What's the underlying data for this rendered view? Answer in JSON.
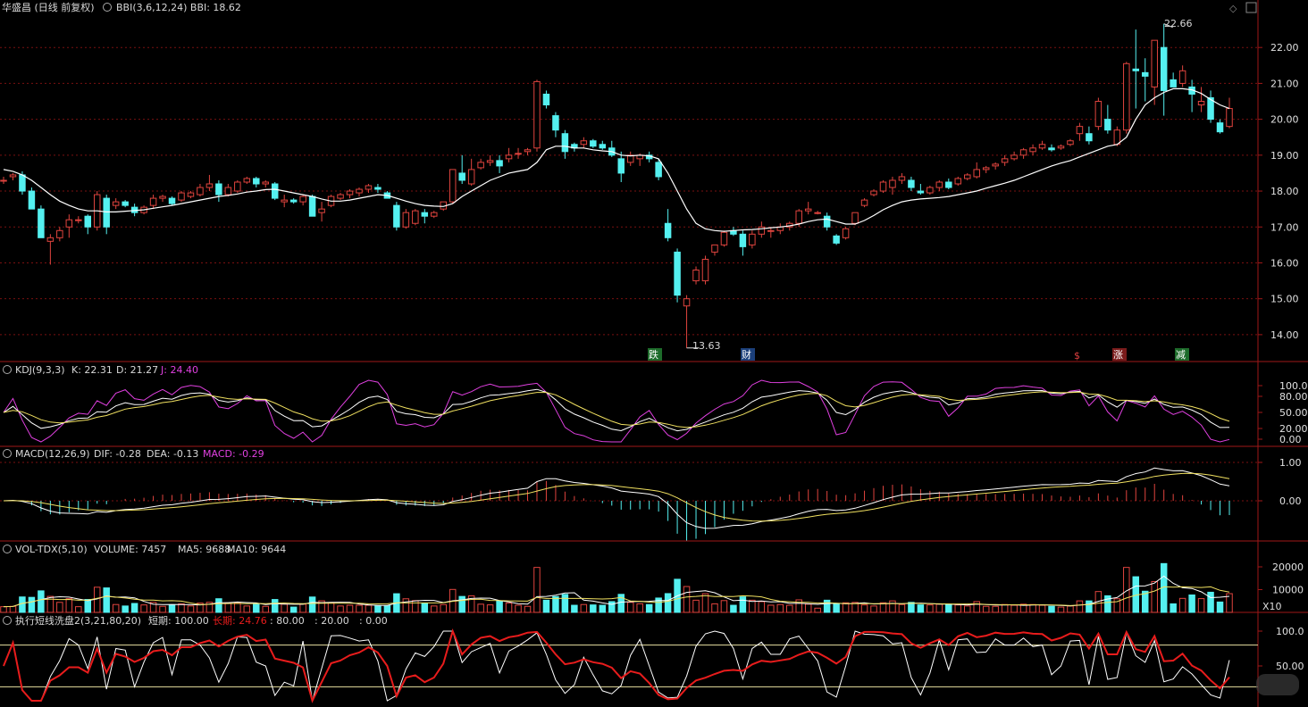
{
  "colors": {
    "up": "#e0443e",
    "down": "#54f0f0",
    "grid": "#7a1010",
    "border": "#a01818",
    "white": "#ffffff",
    "yellow": "#f0e060",
    "magenta": "#e040e0",
    "red": "#e81c1c",
    "green_badge": "#1d6b2a",
    "blue_badge": "#1b3f7a",
    "red_badge": "#7a1b1b"
  },
  "price_panel": {
    "title": "华盛昌 (日线 前复权)",
    "indicator_text": "BBI(3,6,12,24)  BBI: 18.62",
    "y_ticks": [
      "22.00",
      "21.00",
      "20.00",
      "19.00",
      "18.00",
      "17.00",
      "16.00",
      "15.00",
      "14.00"
    ],
    "high_label": "22.66",
    "low_label": "13.63",
    "badges": [
      "跌",
      "财",
      "$",
      "涨",
      "减"
    ]
  },
  "kdj_panel": {
    "name": "KDJ(9,3,3)",
    "k": "K: 22.31",
    "d": "D: 21.27",
    "j": "J: 24.40",
    "y_ticks": [
      "100.00",
      "80.00",
      "50.00",
      "20.00",
      "0.00"
    ]
  },
  "macd_panel": {
    "name": "MACD(12,26,9)",
    "dif": "DIF: -0.28",
    "dea": "DEA: -0.13",
    "macd": "MACD: -0.29",
    "y_ticks": [
      "1.00",
      "0.00"
    ]
  },
  "vol_panel": {
    "name": "VOL-TDX(5,10)",
    "volume": "VOLUME: 7457",
    "ma5": "MA5: 9688",
    "ma10": "MA10: 9644",
    "y_ticks": [
      "20000",
      "10000"
    ],
    "unit": "X10"
  },
  "osc_panel": {
    "name": "执行短线洗盘2(3,21,80,20)",
    "short": "短期: 100.00",
    "long": "长期: 24.76",
    "t80": ": 80.00",
    "t20": ": 20.00",
    "t0": ": 0.00",
    "y_ticks": [
      "100.0",
      "50.00"
    ]
  },
  "chart_data": {
    "type": "candlestick",
    "ylim": [
      13.5,
      22.9
    ],
    "candles": [
      [
        18.3,
        18.4,
        18.2,
        18.3
      ],
      [
        18.4,
        18.5,
        18.3,
        18.45
      ],
      [
        18.45,
        18.55,
        17.9,
        18.0
      ],
      [
        18.0,
        18.1,
        17.5,
        17.5
      ],
      [
        17.5,
        17.6,
        16.7,
        16.7
      ],
      [
        16.6,
        16.8,
        15.95,
        16.7
      ],
      [
        16.7,
        17.0,
        16.6,
        16.9
      ],
      [
        17.0,
        17.35,
        16.7,
        17.2
      ],
      [
        17.2,
        17.3,
        17.1,
        17.2
      ],
      [
        17.3,
        17.35,
        16.8,
        17.0
      ],
      [
        17.0,
        18.0,
        16.9,
        17.9
      ],
      [
        17.8,
        17.9,
        16.8,
        17.0
      ],
      [
        17.6,
        17.8,
        17.5,
        17.7
      ],
      [
        17.7,
        17.75,
        17.55,
        17.6
      ],
      [
        17.55,
        17.65,
        17.3,
        17.4
      ],
      [
        17.4,
        17.6,
        17.35,
        17.55
      ],
      [
        17.6,
        17.9,
        17.5,
        17.8
      ],
      [
        17.8,
        17.9,
        17.7,
        17.85
      ],
      [
        17.8,
        17.85,
        17.6,
        17.65
      ],
      [
        17.75,
        18.0,
        17.7,
        17.95
      ],
      [
        17.85,
        18.0,
        17.8,
        17.95
      ],
      [
        17.9,
        18.2,
        17.85,
        18.1
      ],
      [
        18.1,
        18.45,
        18.0,
        18.2
      ],
      [
        18.2,
        18.3,
        17.7,
        17.9
      ],
      [
        17.9,
        18.2,
        17.85,
        18.1
      ],
      [
        18.0,
        18.3,
        17.95,
        18.25
      ],
      [
        18.25,
        18.4,
        18.2,
        18.35
      ],
      [
        18.35,
        18.4,
        18.1,
        18.2
      ],
      [
        18.2,
        18.3,
        18.1,
        18.25
      ],
      [
        18.2,
        18.25,
        17.75,
        17.8
      ],
      [
        17.7,
        17.9,
        17.55,
        17.75
      ],
      [
        17.75,
        17.8,
        17.65,
        17.7
      ],
      [
        17.7,
        17.9,
        17.6,
        17.85
      ],
      [
        17.85,
        17.9,
        17.3,
        17.3
      ],
      [
        17.4,
        17.7,
        17.15,
        17.5
      ],
      [
        17.6,
        17.9,
        17.55,
        17.85
      ],
      [
        17.8,
        17.95,
        17.75,
        17.9
      ],
      [
        17.9,
        18.05,
        17.8,
        18.0
      ],
      [
        17.95,
        18.1,
        17.85,
        18.05
      ],
      [
        18.05,
        18.2,
        17.95,
        18.15
      ],
      [
        18.1,
        18.2,
        17.95,
        18.05
      ],
      [
        17.95,
        18.0,
        17.8,
        17.8
      ],
      [
        17.6,
        17.7,
        16.9,
        17.0
      ],
      [
        17.0,
        17.5,
        16.95,
        17.4
      ],
      [
        17.1,
        17.5,
        17.05,
        17.45
      ],
      [
        17.4,
        17.5,
        17.1,
        17.3
      ],
      [
        17.3,
        17.45,
        17.25,
        17.4
      ],
      [
        17.5,
        17.7,
        17.45,
        17.7
      ],
      [
        17.7,
        18.6,
        17.65,
        18.6
      ],
      [
        18.5,
        19.0,
        18.2,
        18.3
      ],
      [
        18.2,
        18.9,
        18.15,
        18.6
      ],
      [
        18.65,
        18.9,
        18.6,
        18.8
      ],
      [
        18.8,
        19.0,
        18.7,
        18.85
      ],
      [
        18.85,
        19.0,
        18.5,
        18.7
      ],
      [
        18.9,
        19.2,
        18.8,
        19.0
      ],
      [
        19.05,
        19.2,
        18.9,
        19.05
      ],
      [
        19.1,
        19.2,
        19.0,
        19.15
      ],
      [
        19.2,
        21.1,
        19.1,
        21.05
      ],
      [
        20.7,
        20.8,
        20.3,
        20.4
      ],
      [
        20.1,
        20.2,
        19.5,
        19.7
      ],
      [
        19.6,
        19.7,
        18.9,
        19.1
      ],
      [
        19.3,
        19.35,
        19.1,
        19.2
      ],
      [
        19.3,
        19.5,
        19.2,
        19.4
      ],
      [
        19.4,
        19.45,
        19.2,
        19.25
      ],
      [
        19.3,
        19.4,
        19.15,
        19.2
      ],
      [
        19.2,
        19.4,
        18.95,
        19.0
      ],
      [
        18.9,
        19.1,
        18.25,
        18.5
      ],
      [
        18.8,
        19.1,
        18.7,
        19.0
      ],
      [
        18.9,
        19.05,
        18.7,
        19.0
      ],
      [
        19.0,
        19.1,
        18.8,
        18.9
      ],
      [
        18.8,
        18.9,
        18.3,
        18.4
      ],
      [
        17.1,
        17.5,
        16.6,
        16.7
      ],
      [
        16.3,
        16.4,
        14.9,
        15.1
      ],
      [
        14.8,
        15.1,
        13.63,
        15.0
      ],
      [
        15.5,
        15.9,
        15.4,
        15.8
      ],
      [
        15.5,
        16.2,
        15.4,
        16.1
      ],
      [
        16.3,
        16.5,
        16.2,
        16.5
      ],
      [
        16.5,
        16.9,
        16.45,
        16.85
      ],
      [
        16.9,
        17.0,
        16.75,
        16.8
      ],
      [
        16.8,
        16.9,
        16.2,
        16.45
      ],
      [
        16.5,
        16.9,
        16.4,
        16.8
      ],
      [
        16.8,
        17.15,
        16.7,
        17.0
      ],
      [
        16.9,
        17.0,
        16.7,
        16.9
      ],
      [
        16.9,
        17.1,
        16.8,
        17.0
      ],
      [
        17.0,
        17.15,
        16.9,
        17.1
      ],
      [
        17.1,
        17.5,
        17.0,
        17.45
      ],
      [
        17.45,
        17.7,
        17.35,
        17.5
      ],
      [
        17.4,
        17.45,
        17.35,
        17.4
      ],
      [
        17.3,
        17.4,
        16.9,
        17.0
      ],
      [
        16.75,
        16.8,
        16.5,
        16.55
      ],
      [
        16.7,
        17.0,
        16.65,
        16.95
      ],
      [
        17.1,
        17.4,
        17.05,
        17.4
      ],
      [
        17.6,
        17.8,
        17.55,
        17.75
      ],
      [
        17.9,
        18.05,
        17.85,
        18.0
      ],
      [
        18.0,
        18.3,
        17.95,
        18.25
      ],
      [
        18.1,
        18.4,
        17.9,
        18.3
      ],
      [
        18.3,
        18.5,
        18.2,
        18.4
      ],
      [
        18.3,
        18.4,
        18.0,
        18.1
      ],
      [
        18.0,
        18.2,
        17.9,
        17.95
      ],
      [
        17.95,
        18.15,
        17.9,
        18.1
      ],
      [
        18.1,
        18.3,
        18.0,
        18.25
      ],
      [
        18.25,
        18.35,
        18.05,
        18.1
      ],
      [
        18.2,
        18.4,
        18.15,
        18.35
      ],
      [
        18.35,
        18.5,
        18.3,
        18.45
      ],
      [
        18.4,
        18.8,
        18.35,
        18.6
      ],
      [
        18.6,
        18.7,
        18.5,
        18.65
      ],
      [
        18.7,
        18.8,
        18.6,
        18.75
      ],
      [
        18.8,
        19.0,
        18.7,
        18.9
      ],
      [
        18.9,
        19.1,
        18.85,
        19.0
      ],
      [
        19.0,
        19.2,
        18.9,
        19.15
      ],
      [
        19.1,
        19.3,
        19.0,
        19.2
      ],
      [
        19.2,
        19.4,
        19.15,
        19.3
      ],
      [
        19.2,
        19.3,
        19.1,
        19.15
      ],
      [
        19.2,
        19.3,
        19.15,
        19.25
      ],
      [
        19.3,
        19.45,
        19.25,
        19.4
      ],
      [
        19.6,
        19.9,
        19.4,
        19.8
      ],
      [
        19.6,
        19.8,
        19.3,
        19.4
      ],
      [
        19.8,
        20.6,
        19.7,
        20.5
      ],
      [
        20.0,
        20.4,
        19.6,
        19.7
      ],
      [
        19.3,
        19.8,
        19.25,
        19.7
      ],
      [
        19.7,
        21.6,
        19.6,
        21.55
      ],
      [
        21.4,
        22.5,
        20.3,
        21.35
      ],
      [
        21.3,
        21.7,
        20.5,
        21.2
      ],
      [
        20.9,
        21.7,
        20.4,
        22.2
      ],
      [
        22.0,
        22.66,
        20.1,
        20.8
      ],
      [
        21.1,
        21.3,
        21.0,
        20.9
      ],
      [
        21.0,
        21.5,
        20.9,
        21.35
      ],
      [
        20.9,
        21.1,
        20.2,
        20.7
      ],
      [
        20.4,
        20.9,
        20.2,
        20.5
      ],
      [
        20.6,
        20.8,
        19.9,
        20.0
      ],
      [
        19.9,
        20.0,
        19.6,
        19.65
      ],
      [
        19.8,
        20.6,
        19.75,
        20.3
      ]
    ],
    "bbi": [
      18.6,
      18.55,
      18.45,
      18.3,
      18.1,
      17.9,
      17.72,
      17.6,
      17.5,
      17.45,
      17.45,
      17.42,
      17.42,
      17.44,
      17.46,
      17.48,
      17.52,
      17.56,
      17.6,
      17.65,
      17.7,
      17.75,
      17.8,
      17.85,
      17.88,
      17.92,
      17.97,
      18.0,
      18.04,
      18.05,
      18.0,
      17.95,
      17.9,
      17.85,
      17.78,
      17.72,
      17.72,
      17.75,
      17.8,
      17.85,
      17.9,
      17.88,
      17.8,
      17.72,
      17.65,
      17.6,
      17.58,
      17.57,
      17.65,
      17.85,
      18.0,
      18.15,
      18.3,
      18.4,
      18.5,
      18.55,
      18.6,
      18.8,
      19.15,
      19.25,
      19.25,
      19.2,
      19.2,
      19.15,
      19.12,
      19.1,
      19.0,
      18.98,
      19.0,
      18.98,
      18.9,
      18.5,
      18.0,
      17.5,
      17.1,
      16.95,
      16.9,
      16.88,
      16.9,
      16.92,
      16.93,
      16.95,
      16.98,
      17.0,
      17.03,
      17.08,
      17.15,
      17.2,
      17.22,
      17.15,
      17.08,
      17.08,
      17.18,
      17.32,
      17.48,
      17.6,
      17.7,
      17.75,
      17.78,
      17.8,
      17.82,
      17.85,
      17.9,
      17.95,
      18.0,
      18.08,
      18.15,
      18.22,
      18.3,
      18.4,
      18.5,
      18.6,
      18.7,
      18.78,
      18.85,
      18.95,
      19.05,
      19.15,
      19.25,
      19.3,
      19.5,
      20.0,
      20.4,
      20.6,
      20.75,
      20.85,
      20.85,
      20.82,
      20.72,
      20.55,
      20.4,
      20.3
    ],
    "high_point": 22.66,
    "low_point": 13.63
  }
}
